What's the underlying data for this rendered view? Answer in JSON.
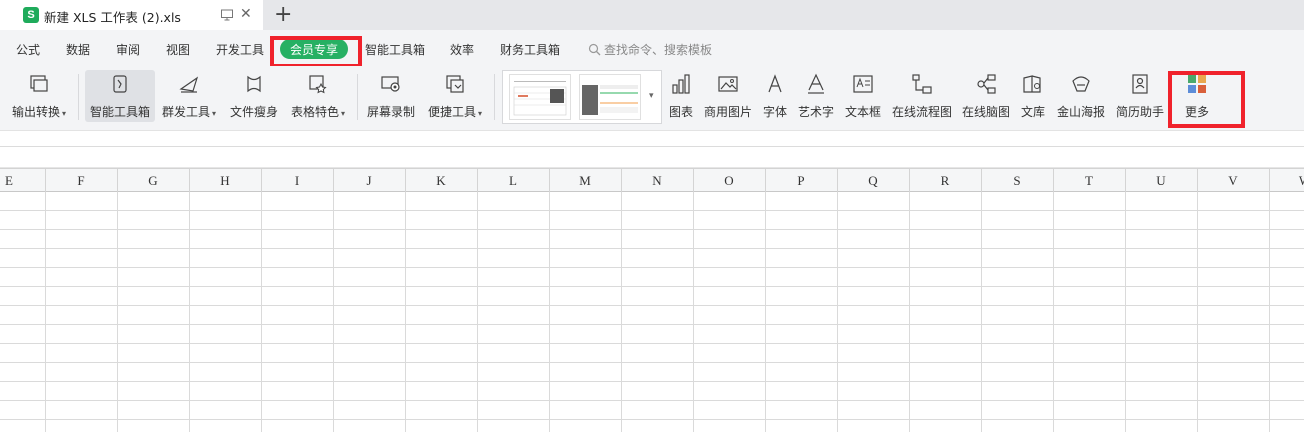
{
  "tab": {
    "logo": "S",
    "title": "新建 XLS 工作表 (2).xls",
    "close": "✕",
    "add": "+"
  },
  "menu": {
    "items": [
      "公式",
      "数据",
      "审阅",
      "视图",
      "开发工具"
    ],
    "vip": "会员专享",
    "after": [
      "智能工具箱",
      "效率",
      "财务工具箱"
    ],
    "search": "查找命令、搜索模板"
  },
  "ribbon": {
    "output": "输出转换",
    "smart_toolbox": "智能工具箱",
    "group_send": "群发工具",
    "file_slim": "文件瘦身",
    "table_feature": "表格特色",
    "screen_record": "屏幕录制",
    "quick_tools": "便捷工具",
    "chart": "图表",
    "commercial_image": "商用图片",
    "font": "字体",
    "art_text": "艺术字",
    "text_box": "文本框",
    "online_flowchart": "在线流程图",
    "online_mindmap": "在线脑图",
    "library": "文库",
    "poster": "金山海报",
    "resume": "简历助手",
    "more": "更多"
  },
  "columns": [
    "E",
    "F",
    "G",
    "H",
    "I",
    "J",
    "K",
    "L",
    "M",
    "N",
    "O",
    "P",
    "Q",
    "R",
    "S",
    "T",
    "U",
    "V",
    "W"
  ],
  "colors": {
    "accent": "#26b063",
    "highlight": "#f0222c",
    "ribbon_bg": "#f3f4f6",
    "tabbar_bg": "#e6e7ea"
  }
}
